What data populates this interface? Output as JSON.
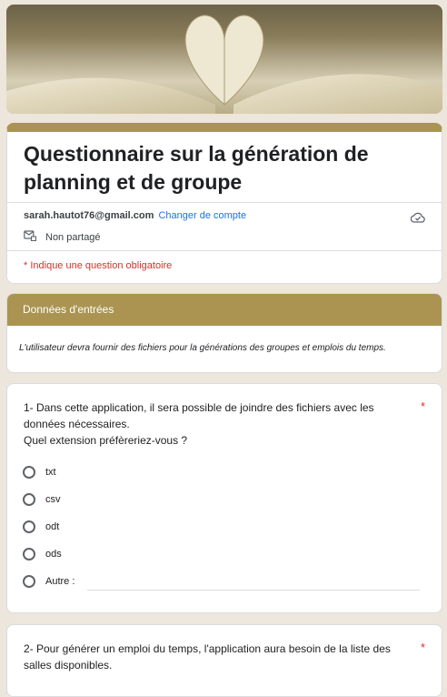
{
  "header": {
    "title": "Questionnaire sur la génération de planning et de groupe",
    "email": "sarah.hautot76@gmail.com",
    "switch_account": "Changer de compte",
    "sharing": "Non partagé",
    "required_note": "* Indique une question obligatoire",
    "icons": [
      "cloud-check-icon",
      "mail-lock-icon"
    ]
  },
  "section": {
    "title": "Données d'entrées",
    "description": "L'utilisateur devra fournir des fichiers pour la générations des groupes et emplois du temps."
  },
  "questions": [
    {
      "line1": "1- Dans cette application, il sera possible de joindre des fichiers avec les données nécessaires.",
      "line2": "Quel extension préfèreriez-vous ?",
      "required": "*",
      "options": [
        "txt",
        "csv",
        "odt",
        "ods",
        "Autre :"
      ]
    },
    {
      "text": "2- Pour générer un emploi du temps, l'application aura besoin de la liste des salles disponibles.",
      "required": "*"
    }
  ],
  "colors": {
    "accent": "#ab9451",
    "link": "#1a73e8",
    "required": "#d93025",
    "background": "#ece6dc"
  }
}
